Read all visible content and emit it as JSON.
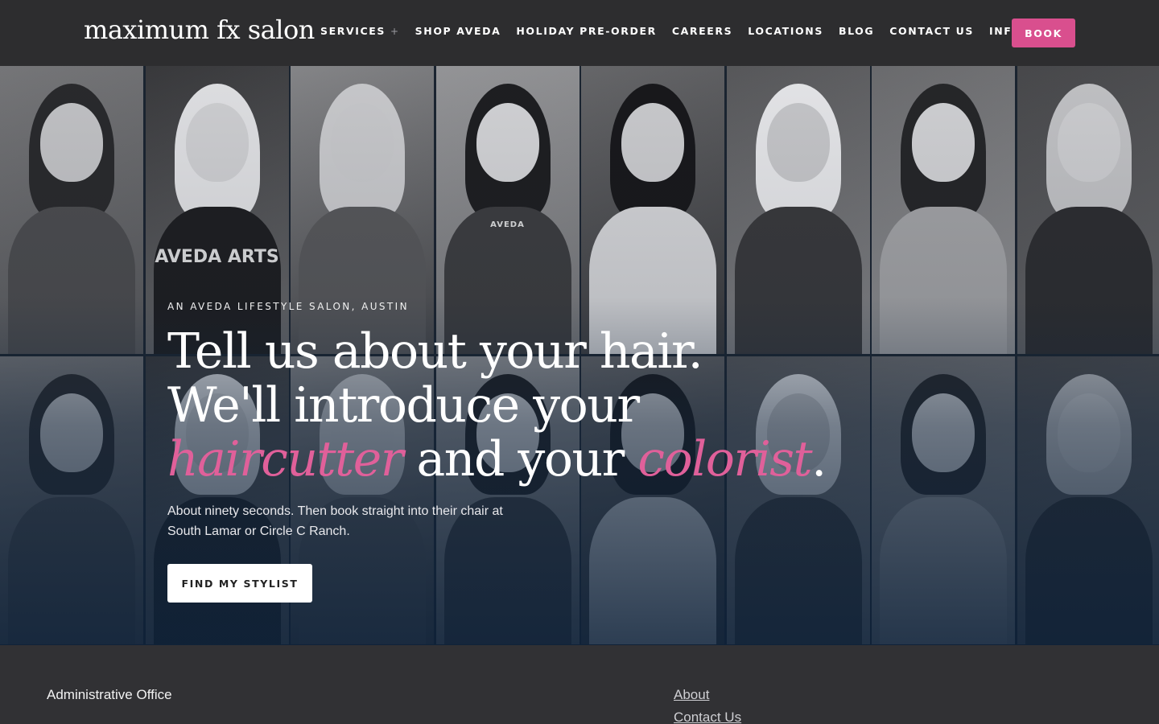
{
  "header": {
    "logo": "maximum fx salon",
    "nav": [
      {
        "label": "SERVICES",
        "plus": "+"
      },
      {
        "label": "SHOP AVEDA",
        "plus": ""
      },
      {
        "label": "HOLIDAY PRE-ORDER",
        "plus": ""
      },
      {
        "label": "CAREERS",
        "plus": ""
      },
      {
        "label": "LOCATIONS",
        "plus": ""
      },
      {
        "label": "BLOG",
        "plus": ""
      },
      {
        "label": "CONTACT US",
        "plus": ""
      },
      {
        "label": "INFO",
        "plus": "+"
      }
    ],
    "book_label": "BOOK"
  },
  "hero": {
    "eyebrow": "AN AVEDA LIFESTYLE SALON, AUSTIN",
    "headline_line1": "Tell us about your hair.",
    "headline_line2": "We'll introduce your",
    "headline_pink1": "haircutter",
    "headline_mid": " and your ",
    "headline_pink2": "colorist",
    "headline_end": ".",
    "subtext": "About ninety seconds. Then book straight into their chair at South Lamar or Circle C Ranch.",
    "cta_label": "FIND MY STYLIST",
    "tile_tshirt_text": "AVEDA ARTS",
    "tile_apron_text": "AVEDA"
  },
  "footer": {
    "left_title": "Administrative Office",
    "links": [
      "About",
      "Contact Us"
    ]
  },
  "colors": {
    "accent_pink": "#d94f8e",
    "header_bg": "#2d2d2f",
    "footer_bg": "#313134"
  }
}
